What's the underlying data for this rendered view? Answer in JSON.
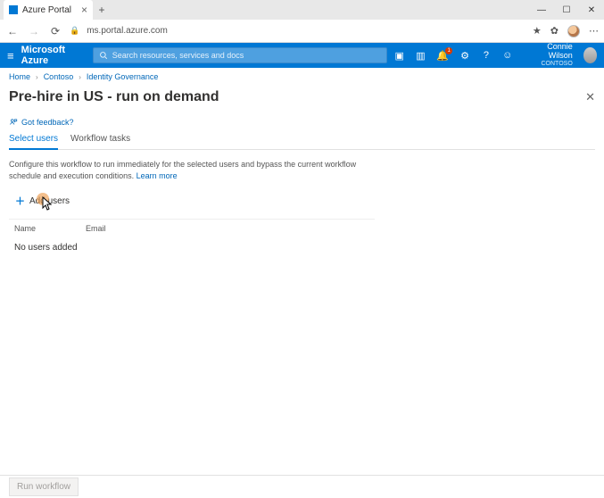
{
  "browser": {
    "tab_title": "Azure Portal",
    "url": "ms.portal.azure.com",
    "win_min": "—",
    "win_max": "☐",
    "win_close": "✕"
  },
  "azure_bar": {
    "brand": "Microsoft Azure",
    "search_placeholder": "Search resources, services and docs",
    "notification_count": "1",
    "user_name": "Connie Wilson",
    "user_directory": "CONTOSO"
  },
  "breadcrumbs": {
    "items": [
      "Home",
      "Contoso",
      "Identity Governance"
    ]
  },
  "panel": {
    "title": "Pre-hire in US - run on demand",
    "feedback_label": "Got feedback?",
    "tabs": {
      "select_users": "Select users",
      "workflow_tasks": "Workflow tasks"
    },
    "description": "Configure this workflow to run immediately for the selected users and bypass the current workflow schedule and execution conditions. ",
    "learn_more": "Learn more",
    "add_users_label": "Add users",
    "columns": {
      "name": "Name",
      "email": "Email"
    },
    "empty_text": "No users added"
  },
  "footer": {
    "run_label": "Run workflow"
  }
}
